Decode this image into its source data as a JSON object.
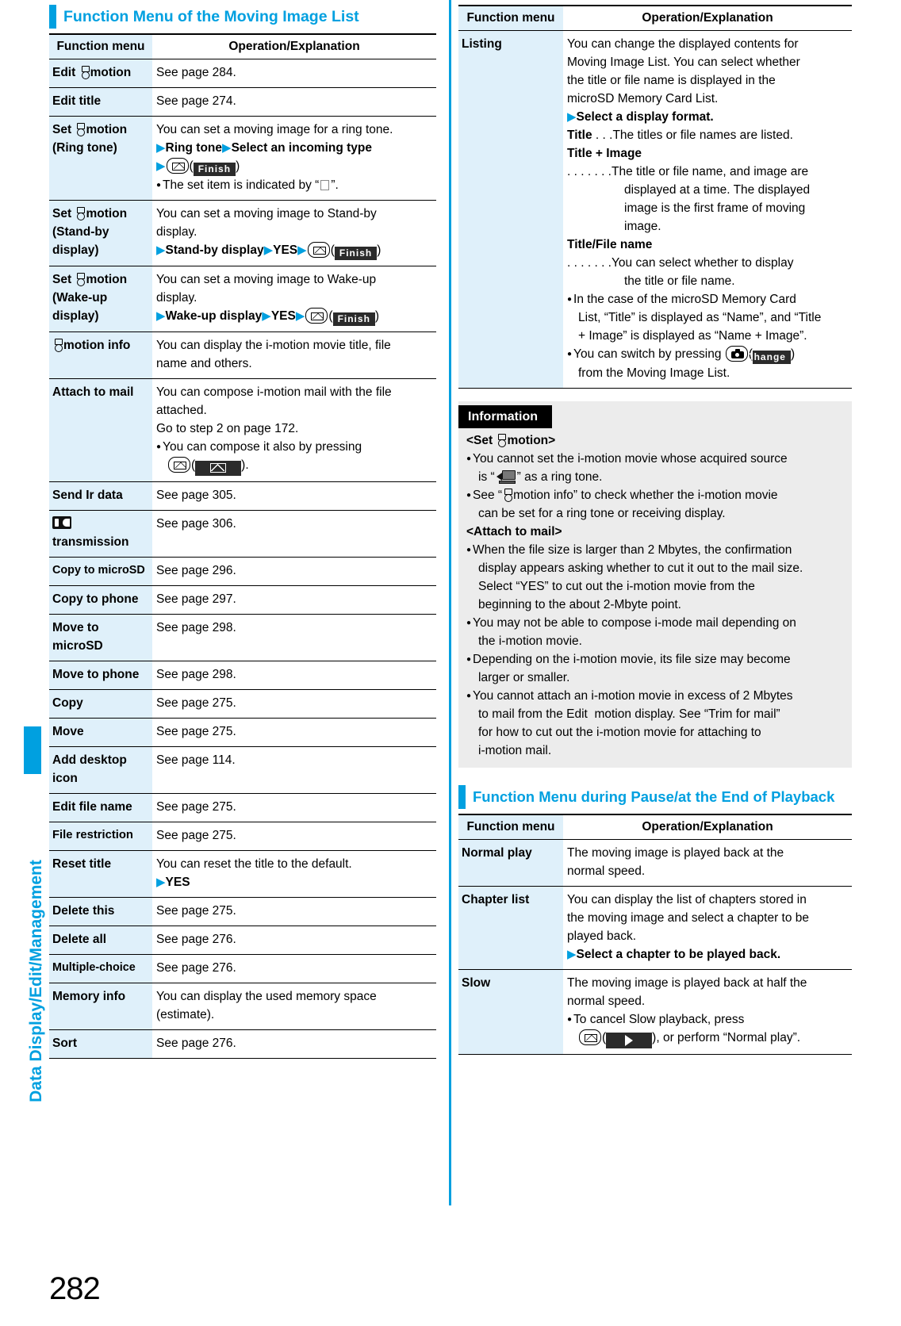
{
  "page_number": "282",
  "side_tab_label": "Data Display/Edit/Management",
  "colors": {
    "accent": "#00a0e0",
    "key_cell": "#dff0fa",
    "info_bg": "#ececec"
  },
  "left_section": {
    "heading": "Function Menu of the Moving Image List",
    "table": {
      "headers": [
        "Function menu",
        "Operation/Explanation"
      ],
      "rows": [
        {
          "key_pre": "Edit ",
          "key_icon": "i-motion-icon",
          "key_post": "motion",
          "lines": [
            {
              "t": "See page 284."
            }
          ]
        },
        {
          "key_pre": "Edit title",
          "key_icon": "",
          "key_post": "",
          "lines": [
            {
              "t": "See page 274."
            }
          ]
        },
        {
          "key_pre": "Set ",
          "key_icon": "i-motion-icon",
          "key_post": "motion",
          "key_line2": "(Ring tone)",
          "lines": [
            {
              "t": "You can set a moving image for a ring tone."
            },
            {
              "t": "Ring tone",
              "t2": "Select an incoming type",
              "type": "steps2"
            },
            {
              "type": "key-finish"
            },
            {
              "t": "The set item is indicated by “",
              "t2": "”.",
              "type": "bullet-square"
            }
          ]
        },
        {
          "key_pre": "Set ",
          "key_icon": "i-motion-icon",
          "key_post": "motion",
          "key_line2": "(Stand-by",
          "key_line3": "display)",
          "lines": [
            {
              "t": "You can set a moving image to Stand-by"
            },
            {
              "t": "display."
            },
            {
              "t": "Stand-by display",
              "t2": "YES",
              "type": "steps-yes-finish"
            }
          ]
        },
        {
          "key_pre": "Set ",
          "key_icon": "i-motion-icon",
          "key_post": "motion",
          "key_line2": "(Wake-up",
          "key_line3": "display)",
          "lines": [
            {
              "t": "You can set a moving image to Wake-up"
            },
            {
              "t": "display."
            },
            {
              "t": "Wake-up display",
              "t2": "YES",
              "type": "steps-yes-finish"
            }
          ]
        },
        {
          "key_pre": "",
          "key_icon": "i-motion-icon",
          "key_post": "motion info",
          "lines": [
            {
              "t": "You can display the i-motion movie title, file"
            },
            {
              "t": "name and others."
            }
          ]
        },
        {
          "key_pre": "Attach to mail",
          "key_icon": "",
          "key_post": "",
          "lines": [
            {
              "t": "You can compose i-motion mail with the file"
            },
            {
              "t": "attached."
            },
            {
              "t": "Go to step 2 on page 172."
            },
            {
              "t": "You can compose it also by pressing",
              "type": "bullet"
            },
            {
              "type": "key-mail-softkey"
            }
          ]
        },
        {
          "key_pre": "Send Ir data",
          "key_icon": "",
          "key_post": "",
          "lines": [
            {
              "t": "See page 305."
            }
          ]
        },
        {
          "key_pre": "",
          "key_icon": "ic-transmission-icon",
          "key_post": "",
          "key_line2": "transmission",
          "lines": [
            {
              "t": "See page 306."
            }
          ]
        },
        {
          "key_pre": "Copy to microSD",
          "key_icon": "",
          "key_post": "",
          "small": true,
          "lines": [
            {
              "t": "See page 296."
            }
          ]
        },
        {
          "key_pre": "Copy to phone",
          "key_icon": "",
          "key_post": "",
          "lines": [
            {
              "t": "See page 297."
            }
          ]
        },
        {
          "key_pre": "Move to",
          "key_icon": "",
          "key_post": "",
          "key_line2": "microSD",
          "lines": [
            {
              "t": "See page 298."
            }
          ]
        },
        {
          "key_pre": "Move to phone",
          "key_icon": "",
          "key_post": "",
          "lines": [
            {
              "t": "See page 298."
            }
          ]
        },
        {
          "key_pre": "Copy",
          "key_icon": "",
          "key_post": "",
          "lines": [
            {
              "t": "See page 275."
            }
          ]
        },
        {
          "key_pre": "Move",
          "key_icon": "",
          "key_post": "",
          "lines": [
            {
              "t": "See page 275."
            }
          ]
        },
        {
          "key_pre": "Add desktop",
          "key_icon": "",
          "key_post": "",
          "key_line2": "icon",
          "lines": [
            {
              "t": "See page 114."
            }
          ]
        },
        {
          "key_pre": "Edit file name",
          "key_icon": "",
          "key_post": "",
          "lines": [
            {
              "t": "See page 275."
            }
          ]
        },
        {
          "key_pre": "File restriction",
          "key_icon": "",
          "key_post": "",
          "lines": [
            {
              "t": "See page 275."
            }
          ]
        },
        {
          "key_pre": "Reset title",
          "key_icon": "",
          "key_post": "",
          "lines": [
            {
              "t": "You can reset the title to the default."
            },
            {
              "t": "YES",
              "type": "step-single"
            }
          ]
        },
        {
          "key_pre": "Delete this",
          "key_icon": "",
          "key_post": "",
          "lines": [
            {
              "t": "See page 275."
            }
          ]
        },
        {
          "key_pre": "Delete all",
          "key_icon": "",
          "key_post": "",
          "lines": [
            {
              "t": "See page 276."
            }
          ]
        },
        {
          "key_pre": "Multiple-choice",
          "key_icon": "",
          "key_post": "",
          "lines": [
            {
              "t": "See page 276."
            }
          ]
        },
        {
          "key_pre": "Memory info",
          "key_icon": "",
          "key_post": "",
          "lines": [
            {
              "t": "You can display the used memory space"
            },
            {
              "t": "(estimate)."
            }
          ]
        },
        {
          "key_pre": "Sort",
          "key_icon": "",
          "key_post": "",
          "lines": [
            {
              "t": "See page 276."
            }
          ]
        }
      ]
    }
  },
  "right_section": {
    "table1": {
      "headers": [
        "Function menu",
        "Operation/Explanation"
      ],
      "row_key": "Listing",
      "lines": [
        "You can change the displayed contents for",
        "Moving Image List. You can select whether",
        "the title or file name is displayed in the",
        "microSD Memory Card List."
      ],
      "step": "Select a display format.",
      "opt1_label": "Title",
      "opt1_dots": ". . .",
      "opt1_text": "The titles or file names are listed.",
      "opt2_label": "Title + Image",
      "opt2_dots": ". . . . . . .",
      "opt2_lines": [
        "The title or file name, and image are",
        "displayed at a time. The displayed",
        "image is the first frame of moving",
        "image."
      ],
      "opt3_label": "Title/File name",
      "opt3_dots": ". . . . . . .",
      "opt3_lines": [
        "You can select whether to display",
        "the title or file name."
      ],
      "note1": [
        "In the case of the microSD Memory Card",
        "List, “Title” is displayed as “Name”, and “Title",
        "+ Image” is displayed as “Name + Image”."
      ],
      "note2_pre": "You can switch by pressing",
      "note2_softkey": "Change",
      "note2_post": "from the Moving Image List."
    },
    "information": {
      "title": "Information",
      "sub1_pre": "<Set ",
      "sub1_post": "motion>",
      "items1": [
        {
          "lines": [
            "You cannot set the i-motion movie whose acquired source",
            "is “",
            "” as a ring tone."
          ],
          "icon_line": 1
        },
        {
          "lines": [
            "See “",
            "motion info” to check whether the i-motion movie",
            "can be set for a ring tone or receiving display."
          ],
          "icon_line": 0
        }
      ],
      "sub2": "<Attach to mail>",
      "items2": [
        [
          "When the file size is larger than 2 Mbytes, the confirmation",
          "display appears asking whether to cut it out to the mail size.",
          "Select “YES” to cut out the i-motion movie from the",
          "beginning to the about 2-Mbyte point."
        ],
        [
          "You may not be able to compose i-mode mail depending on",
          "the i-motion movie."
        ],
        [
          "Depending on the i-motion movie, its file size may become",
          "larger or smaller."
        ],
        [
          "You cannot attach an i-motion movie in excess of 2 Mbytes",
          "to mail from the Edit  motion display. See “Trim for mail”",
          "for how to cut out the i-motion movie for attaching to",
          "i-motion mail."
        ]
      ]
    },
    "heading2": "Function Menu during Pause/at the End of Playback",
    "table2": {
      "headers": [
        "Function menu",
        "Operation/Explanation"
      ],
      "rows": [
        {
          "key": "Normal play",
          "lines": [
            "The moving image is played back at the",
            "normal speed."
          ]
        },
        {
          "key": "Chapter list",
          "lines": [
            "You can display the list of chapters stored in",
            "the moving image and select a chapter to be",
            "played back."
          ],
          "step": "Select a chapter to be played back."
        },
        {
          "key": "Slow",
          "lines": [
            "The moving image is played back at half the",
            "normal speed."
          ],
          "bullet_pre": "To cancel Slow playback, press",
          "bullet_post": ", or perform “Normal play”."
        }
      ]
    }
  }
}
